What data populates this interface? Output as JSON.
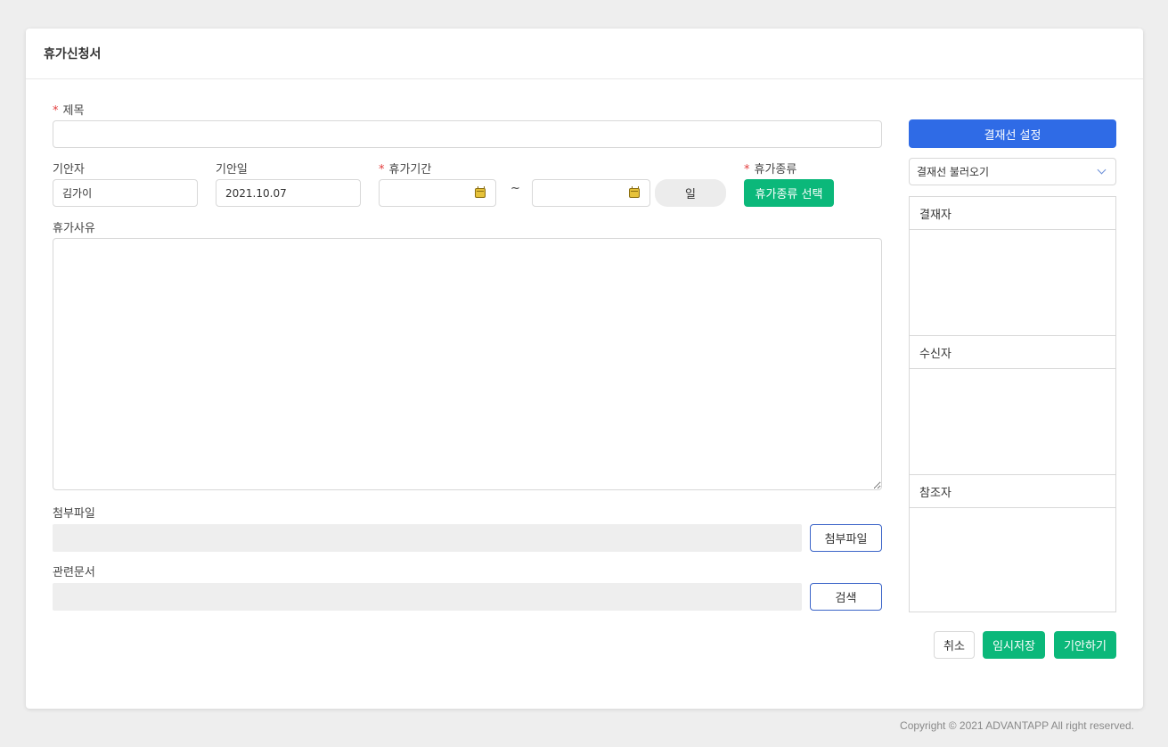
{
  "form": {
    "title": "휴가신청서",
    "subject_label": "제목",
    "subject_value": "",
    "drafter_label": "기안자",
    "drafter_value": "김가이",
    "draft_date_label": "기안일",
    "draft_date_value": "2021.10.07",
    "period_label": "휴가기간",
    "period_start": "",
    "period_separator": "~",
    "days_label": "일",
    "leave_type_label": "휴가종류",
    "leave_type_button": "휴가종류 선택",
    "reason_label": "휴가사유",
    "reason_value": "",
    "attachment_label": "첨부파일",
    "attachment_button": "첨부파일",
    "related_docs_label": "관련문서",
    "related_docs_button": "검색"
  },
  "approval": {
    "setup_button": "결재선 설정",
    "load_select_value": "결재선 불러오기",
    "approvers_label": "결재자",
    "recipients_label": "수신자",
    "references_label": "참조자"
  },
  "actions": {
    "cancel": "취소",
    "save_draft": "임시저장",
    "submit": "기안하기"
  },
  "footer": {
    "copyright": "Copyright © 2021 ADVANTAPP All right reserved."
  },
  "colors": {
    "primary_blue": "#2f6be6",
    "green": "#0bb87a",
    "required": "#e23c3c",
    "background": "#eeeeee"
  },
  "icons": {
    "calendar": "calendar-icon",
    "dropdown": "chevron-down-icon"
  }
}
